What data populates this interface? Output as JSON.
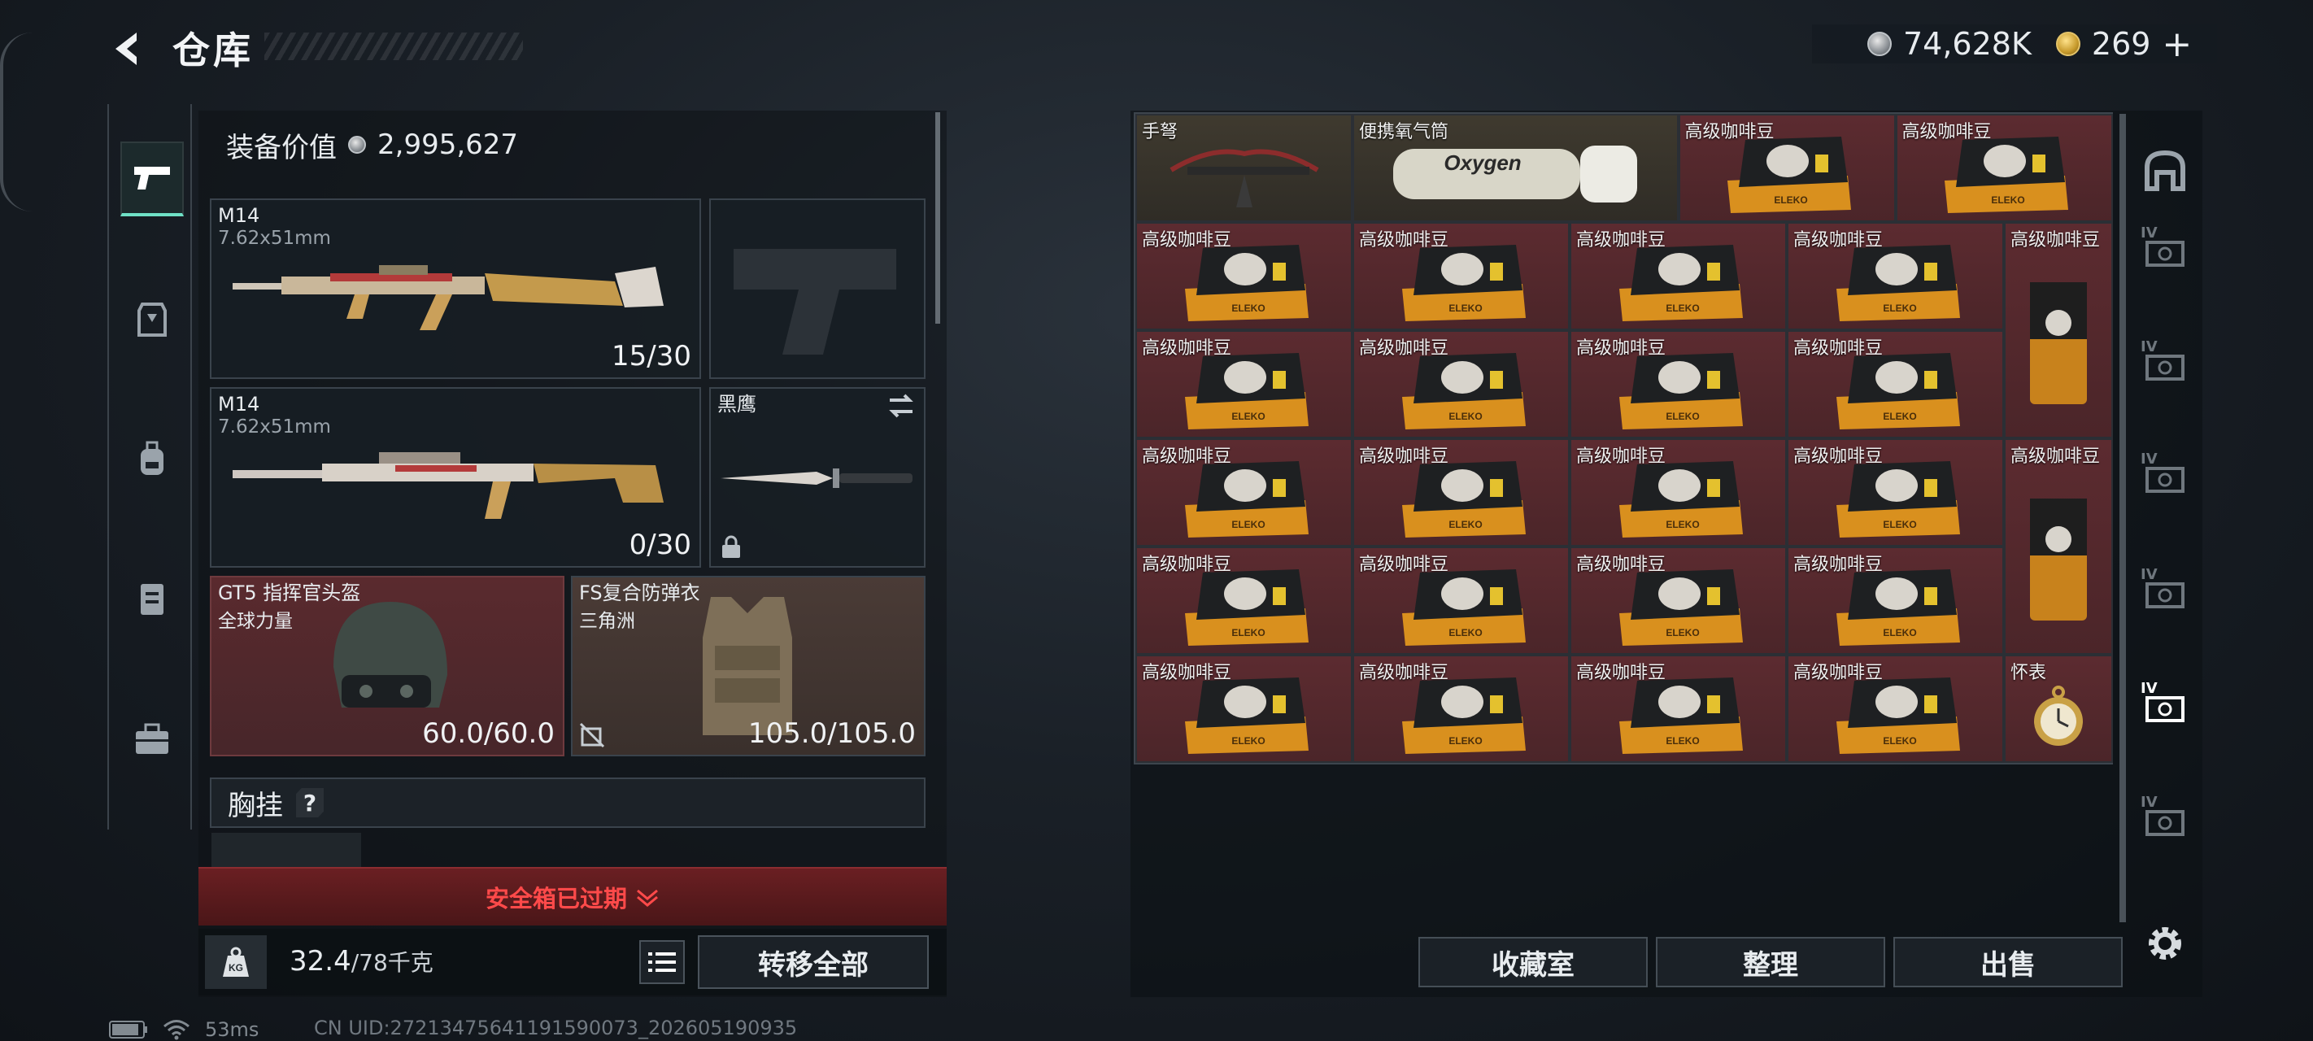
{
  "header": {
    "title": "仓库",
    "coins": "74,628K",
    "gold": "269",
    "plus": "+"
  },
  "nav": {
    "items": [
      "weapon-icon",
      "armor-icon",
      "backpack-icon",
      "vest-icon",
      "briefcase-icon"
    ]
  },
  "loadout": {
    "value_label": "装备价值",
    "value": "2,995,627",
    "primary1": {
      "name": "M14",
      "caliber": "7.62x51mm",
      "ammo": "15/30"
    },
    "primary2": {
      "name": "M14",
      "caliber": "7.62x51mm",
      "ammo": "0/30"
    },
    "melee": {
      "name": "黑鹰"
    },
    "helmet": {
      "name": "GT5 指挥官头盔",
      "faction": "全球力量",
      "durability": "60.0/60.0"
    },
    "armor": {
      "name": "FS复合防弹衣",
      "faction": "三角洲",
      "durability": "105.0/105.0"
    },
    "chest_label": "胸挂",
    "chest_badge": "?",
    "warning": "安全箱已过期",
    "weight": "32.4",
    "weight_unit": "/78千克",
    "transfer": "转移全部",
    "kg": "KG"
  },
  "storage": {
    "items": [
      "手弩",
      "便携氧气筒",
      "高级咖啡豆",
      "高级咖啡豆",
      "高级咖啡豆",
      "高级咖啡豆",
      "高级咖啡豆",
      "高级咖啡豆",
      "高级咖啡豆",
      "高级咖啡豆",
      "高级咖啡豆",
      "高级咖啡豆",
      "高级咖啡豆",
      "高级咖啡豆",
      "高级咖啡豆",
      "高级咖啡豆",
      "高级咖啡豆",
      "高级咖啡豆",
      "高级咖啡豆",
      "高级咖啡豆",
      "高级咖啡豆",
      "高级咖啡豆",
      "高级咖啡豆",
      "高级咖啡豆",
      "高级咖啡豆",
      "高级咖啡豆",
      "怀表"
    ],
    "oxygen_text": "Oxygen",
    "bag_text": "ELEKO",
    "buttons": {
      "collection": "收藏室",
      "sort": "整理",
      "sell": "出售"
    },
    "tier": "IV"
  },
  "status": {
    "ping": "53ms",
    "uid": "CN UID:27213475641191590073_202605190935"
  },
  "colors": {
    "rarity_red": "#5c2b30",
    "accent_green": "#6fe1c6",
    "warning_red": "#ff4a4a"
  }
}
